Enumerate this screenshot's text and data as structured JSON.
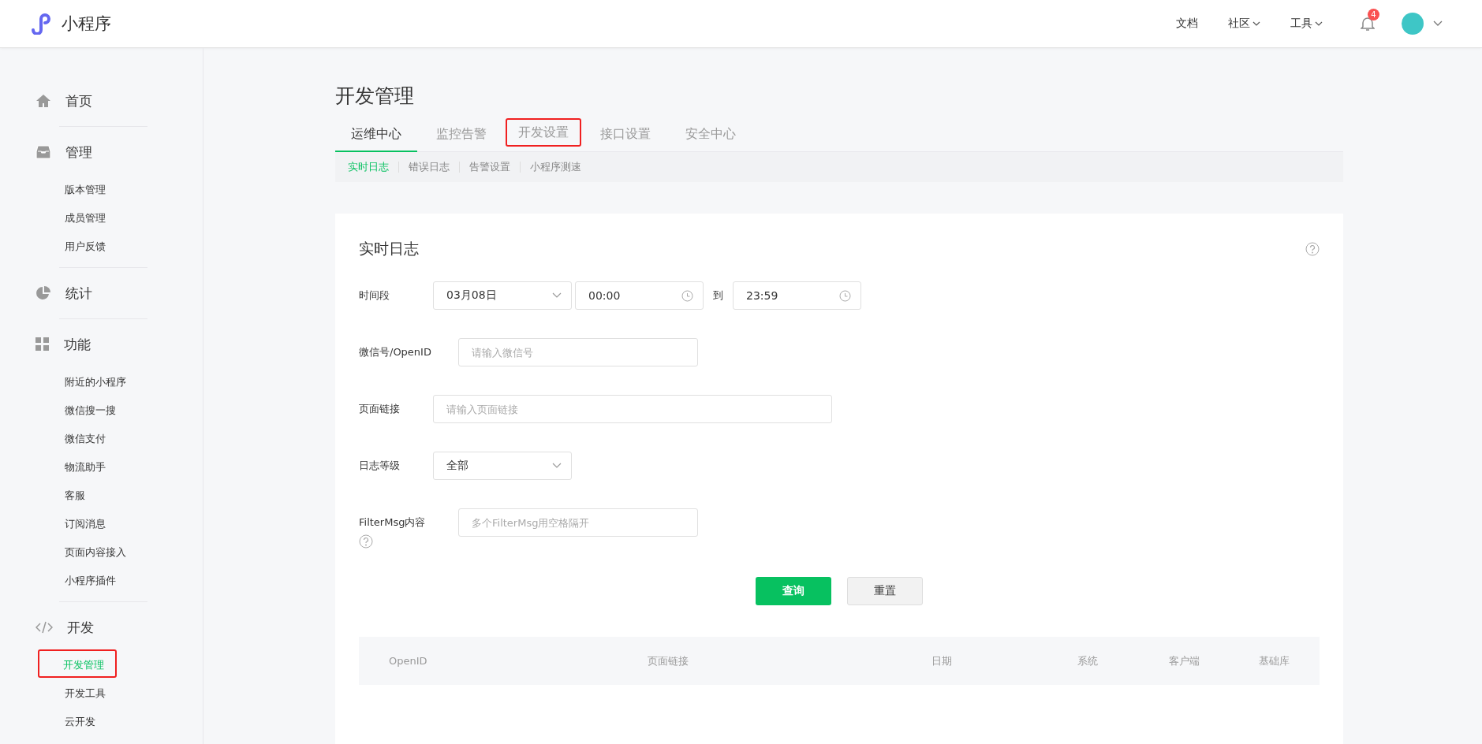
{
  "header": {
    "brand": "小程序",
    "nav": [
      {
        "label": "文档",
        "dropdown": false
      },
      {
        "label": "社区",
        "dropdown": true
      },
      {
        "label": "工具",
        "dropdown": true
      }
    ],
    "notification_count": "4"
  },
  "sidebar": {
    "sections": [
      {
        "label": "首页"
      },
      {
        "label": "管理",
        "items": [
          {
            "label": "版本管理",
            "selected": false,
            "highlighted": false
          },
          {
            "label": "成员管理",
            "selected": false,
            "highlighted": false
          },
          {
            "label": "用户反馈",
            "selected": false,
            "highlighted": false
          }
        ]
      },
      {
        "label": "统计"
      },
      {
        "label": "功能",
        "items": [
          {
            "label": "附近的小程序",
            "selected": false,
            "highlighted": false
          },
          {
            "label": "微信搜一搜",
            "selected": false,
            "highlighted": false
          },
          {
            "label": "微信支付",
            "selected": false,
            "highlighted": false
          },
          {
            "label": "物流助手",
            "selected": false,
            "highlighted": false
          },
          {
            "label": "客服",
            "selected": false,
            "highlighted": false
          },
          {
            "label": "订阅消息",
            "selected": false,
            "highlighted": false
          },
          {
            "label": "页面内容接入",
            "selected": false,
            "highlighted": false
          },
          {
            "label": "小程序插件",
            "selected": false,
            "highlighted": false
          }
        ]
      },
      {
        "label": "开发",
        "items": [
          {
            "label": "开发管理",
            "selected": true,
            "highlighted": true
          },
          {
            "label": "开发工具",
            "selected": false,
            "highlighted": false
          },
          {
            "label": "云开发",
            "selected": false,
            "highlighted": false
          }
        ]
      }
    ]
  },
  "page_title": "开发管理",
  "tabs": [
    {
      "label": "运维中心",
      "selected": true,
      "highlighted": false
    },
    {
      "label": "监控告警",
      "selected": false,
      "highlighted": false
    },
    {
      "label": "开发设置",
      "selected": false,
      "highlighted": true
    },
    {
      "label": "接口设置",
      "selected": false,
      "highlighted": false
    },
    {
      "label": "安全中心",
      "selected": false,
      "highlighted": false
    }
  ],
  "subtabs": [
    {
      "label": "实时日志",
      "selected": true
    },
    {
      "label": "错误日志",
      "selected": false
    },
    {
      "label": "告警设置",
      "selected": false
    },
    {
      "label": "小程序测速",
      "selected": false
    }
  ],
  "card": {
    "title": "实时日志",
    "time_range": {
      "label": "时间段",
      "date": "03月08日",
      "start": "00:00",
      "separator": "到",
      "end": "23:59"
    },
    "wechat_id": {
      "label": "微信号/OpenID",
      "placeholder": "请输入微信号"
    },
    "page_link": {
      "label": "页面链接",
      "placeholder": "请输入页面链接"
    },
    "log_level": {
      "label": "日志等级",
      "value": "全部"
    },
    "filter_msg": {
      "label": "FilterMsg内容",
      "placeholder": "多个FilterMsg用空格隔开"
    },
    "buttons": [
      {
        "label": "查询",
        "kind": "primary"
      },
      {
        "label": "重置",
        "kind": "default"
      }
    ],
    "table": {
      "columns": [
        "OpenID",
        "页面链接",
        "日期",
        "系统",
        "客户端",
        "基础库"
      ]
    }
  }
}
